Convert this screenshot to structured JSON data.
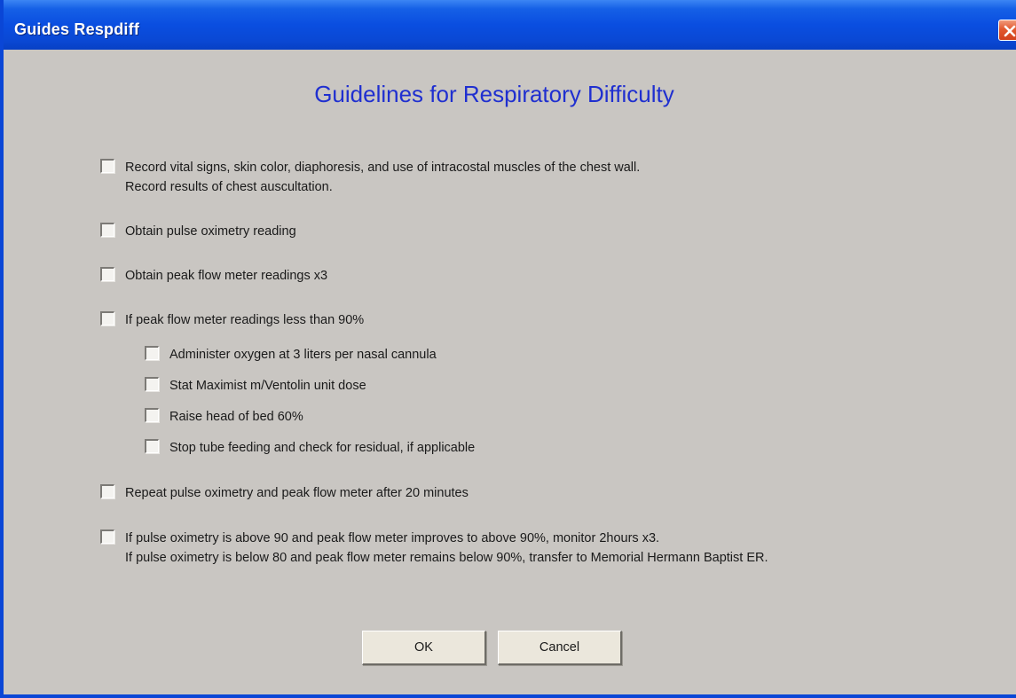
{
  "window": {
    "title": "Guides Respdiff"
  },
  "heading": "Guidelines for Respiratory Difficulty",
  "items": [
    {
      "line1": "Record vital signs, skin color, diaphoresis, and use of intracostal muscles of the chest wall.",
      "line2": "Record results of chest auscultation.",
      "checked": false
    },
    {
      "line1": "Obtain pulse oximetry reading",
      "checked": false
    },
    {
      "line1": "Obtain peak flow meter readings x3",
      "checked": false
    },
    {
      "line1": "If peak flow meter readings less than 90%",
      "checked": false,
      "subitems": [
        {
          "label": "Administer oxygen at 3 liters per nasal cannula",
          "checked": false
        },
        {
          "label": "Stat Maximist m/Ventolin unit dose",
          "checked": false
        },
        {
          "label": "Raise head of bed 60%",
          "checked": false
        },
        {
          "label": "Stop tube feeding and check for residual, if applicable",
          "checked": false
        }
      ]
    },
    {
      "line1": "Repeat pulse oximetry and peak flow meter after 20 minutes",
      "checked": false
    },
    {
      "line1": "If pulse oximetry is above 90 and peak flow meter improves to above 90%, monitor 2hours x3.",
      "line2": "If pulse oximetry is below 80 and peak flow meter remains below 90%, transfer to Memorial Hermann Baptist ER.",
      "checked": false
    }
  ],
  "buttons": {
    "ok_label": "OK",
    "cancel_label": "Cancel"
  },
  "colors": {
    "titlebar": "#0a4ee0",
    "heading": "#1f2fd0",
    "dialog_bg": "#c9c6c2",
    "close_button": "#e2582e"
  },
  "icons": {
    "close": "close-icon"
  }
}
